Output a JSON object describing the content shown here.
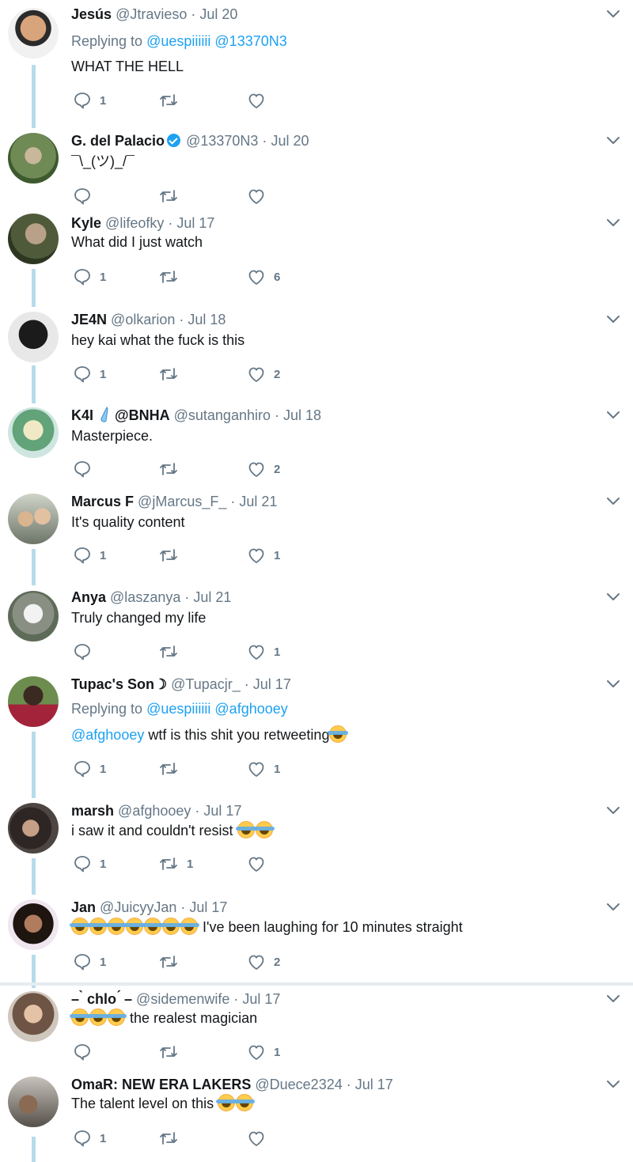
{
  "colors": {
    "link": "#1da1f2",
    "muted": "#657786",
    "thread": "#b6dcec",
    "verified": "#1da1f2"
  },
  "icons": {
    "reply": "reply-icon",
    "retweet": "retweet-icon",
    "like": "heart-icon",
    "more": "chevron-down-icon"
  },
  "tweets": [
    {
      "name": "Jesús",
      "handle": "@Jtravieso",
      "date": "Jul 20",
      "replying_prefix": "Replying to",
      "replying_to": [
        "@uespiiiiii",
        "@13370N3"
      ],
      "text": "WHAT THE HELL",
      "replies": "1",
      "retweets": "",
      "likes": ""
    },
    {
      "name": "G. del Palacio",
      "handle": "@13370N3",
      "date": "Jul 20",
      "text": "¯\\_(ツ)_/¯",
      "replies": "",
      "retweets": "",
      "likes": ""
    },
    {
      "name": "Kyle",
      "handle": "@lifeofky",
      "date": "Jul 17",
      "text": "What did I just watch",
      "replies": "1",
      "retweets": "",
      "likes": "6"
    },
    {
      "name": "JE4N",
      "handle": "@olkarion",
      "date": "Jul 18",
      "text": "hey kai what the fuck is this",
      "replies": "1",
      "retweets": "",
      "likes": "2"
    },
    {
      "name": "K4I",
      "name_suffix": "@BNHA",
      "handle": "@sutanganhiro",
      "date": "Jul 18",
      "text": "Masterpiece.",
      "replies": "",
      "retweets": "",
      "likes": "2"
    },
    {
      "name": "Marcus F",
      "handle": "@jMarcus_F_",
      "date": "Jul 21",
      "text": "It's quality content",
      "replies": "1",
      "retweets": "",
      "likes": "1"
    },
    {
      "name": "Anya",
      "handle": "@laszanya",
      "date": "Jul 21",
      "text": "Truly changed my life",
      "replies": "",
      "retweets": "",
      "likes": "1"
    },
    {
      "name": "Tupac's Son",
      "name_suffix": "☽",
      "handle": "@Tupacjr_",
      "date": "Jul 17",
      "replying_prefix": "Replying to",
      "replying_to": [
        "@uespiiiiii",
        "@afghooey"
      ],
      "mention": "@afghooey",
      "text": "wtf is this shit you retweeting",
      "replies": "1",
      "retweets": "",
      "likes": "1"
    },
    {
      "name": "marsh",
      "handle": "@afghooey",
      "date": "Jul 17",
      "text": "i saw it and couldn't resist",
      "replies": "1",
      "retweets": "1",
      "likes": ""
    },
    {
      "name": "Jan",
      "handle": "@JuicyyJan",
      "date": "Jul 17",
      "text": "I've been laughing for 10 minutes straight",
      "replies": "1",
      "retweets": "",
      "likes": "2"
    },
    {
      "name": "– ̀ chlo ́ –",
      "handle": "@sidemenwife",
      "date": "Jul 17",
      "text": "the realest magician",
      "replies": "",
      "retweets": "",
      "likes": "1"
    },
    {
      "name": "OmaR: NEW ERA LAKERS",
      "handle": "@Duece2324",
      "date": "Jul 17",
      "text": "The talent level on this",
      "replies": "1",
      "retweets": "",
      "likes": ""
    }
  ]
}
